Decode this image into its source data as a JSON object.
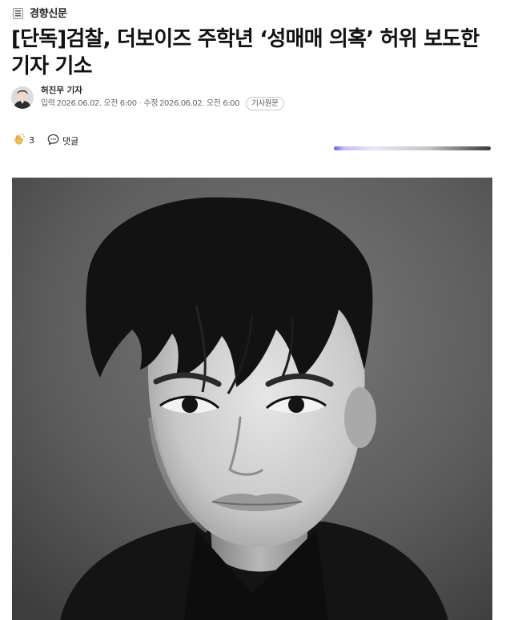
{
  "publisher": {
    "name": "경향신문",
    "logo_icon": "khan-logo-icon"
  },
  "article": {
    "title": "[단독]검찰, 더보이즈 주학년 ‘성매매 의혹’ 허위 보도한 기자 기소",
    "author": "허진무 기자",
    "published_label": "입력",
    "published": "2026.06.02. 오전 6:00",
    "separator": "·",
    "modified_label": "수정",
    "modified": "2026.06.02. 오전 6:00",
    "original_button": "기사원문"
  },
  "reactions": {
    "like_icon": "clap-icon",
    "like_count": "3",
    "comment_icon": "speech-bubble-icon",
    "comment_label": "댓글"
  },
  "photo": {
    "subject": "black-and-white portrait photo"
  },
  "colors": {
    "text": "#111111",
    "muted": "#666666",
    "photo_bg": "#5b5b5b"
  }
}
